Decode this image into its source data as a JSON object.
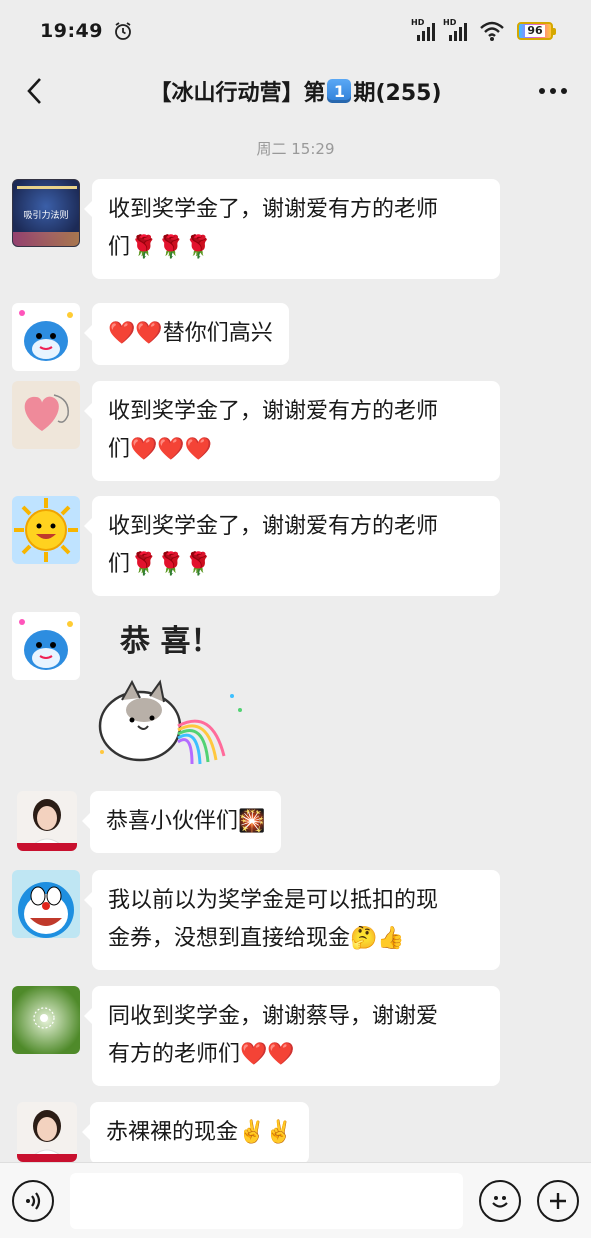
{
  "status_bar": {
    "time": "19:49",
    "battery": "96",
    "signal_1_label": "HD",
    "signal_2_label": "HD",
    "icons": [
      "alarm-icon",
      "signal-icon",
      "signal-icon",
      "wifi-icon",
      "battery-icon"
    ]
  },
  "header": {
    "title_prefix": "【冰山行动营】第",
    "title_badge": "1",
    "title_suffix": "期(255)",
    "back_icon": "chevron-left-icon",
    "more_icon": "more-horizontal-icon"
  },
  "chat": {
    "timestamp": "周二 15:29",
    "messages": [
      {
        "avatar": "poster-avatar",
        "avatar_text": "吸引力法则",
        "line1": "收到奖学金了，谢谢爱有方的老师",
        "line2": "们",
        "emoji": "🌹🌹🌹"
      },
      {
        "avatar": "dolphin-avatar",
        "line1": "替你们高兴",
        "emoji_prefix": "❤️❤️"
      },
      {
        "avatar": "heart-avatar",
        "line1": "收到奖学金了，谢谢爱有方的老师",
        "line2": "们",
        "emoji": "❤️❤️❤️"
      },
      {
        "avatar": "sun-avatar",
        "line1": "收到奖学金了，谢谢爱有方的老师",
        "line2": "们",
        "emoji": "🌹🌹🌹"
      },
      {
        "avatar": "dolphin-avatar",
        "sticker_text": "恭 喜！"
      },
      {
        "avatar": "woman-avatar",
        "line1": "恭喜小伙伴们",
        "emoji": "🎇"
      },
      {
        "avatar": "doraemon-avatar",
        "line1": "我以前以为奖学金是可以抵扣的现",
        "line2": "金券，没想到直接给现金",
        "emoji": "🤔👍"
      },
      {
        "avatar": "dandelion-avatar",
        "line1": "同收到奖学金，谢谢蔡导，谢谢爱",
        "line2": "有方的老师们",
        "emoji": "❤️❤️"
      },
      {
        "avatar": "woman-avatar",
        "line1": "赤裸裸的现金",
        "emoji": "✌️✌️"
      }
    ]
  },
  "input_bar": {
    "voice_icon": "voice-icon",
    "emoji_icon": "smiley-icon",
    "plus_icon": "plus-icon"
  },
  "colors": {
    "background": "#ededed",
    "bubble": "#ffffff",
    "timestamp": "#999999",
    "badge": "#2f7fd8"
  }
}
